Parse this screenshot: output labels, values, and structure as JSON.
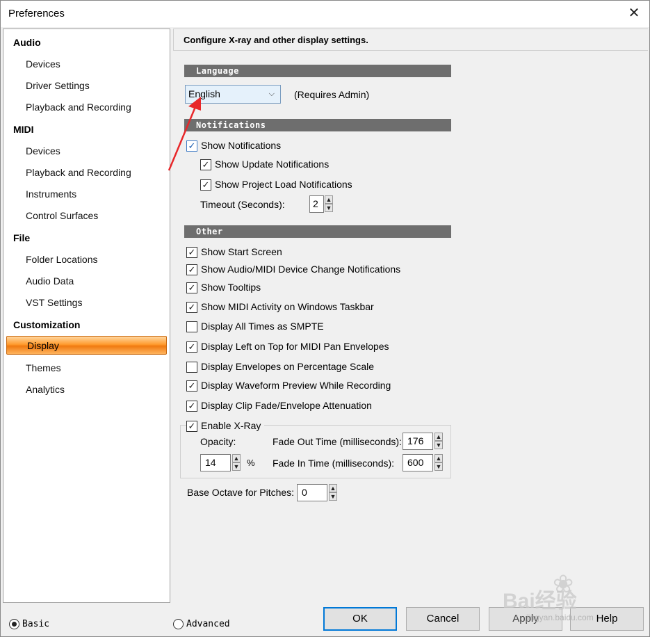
{
  "window": {
    "title": "Preferences",
    "close_glyph": "✕"
  },
  "sidebar": {
    "groups": [
      {
        "label": "Audio",
        "items": [
          "Devices",
          "Driver Settings",
          "Playback and Recording"
        ]
      },
      {
        "label": "MIDI",
        "items": [
          "Devices",
          "Playback and Recording",
          "Instruments",
          "Control Surfaces"
        ]
      },
      {
        "label": "File",
        "items": [
          "Folder Locations",
          "Audio Data",
          "VST Settings"
        ]
      },
      {
        "label": "Customization",
        "items": [
          "Display",
          "Themes",
          "Analytics"
        ]
      }
    ],
    "selected": "Display",
    "selected_color": "#f08a1e"
  },
  "main": {
    "header": "Configure X-ray and other display settings.",
    "language": {
      "section": "Language",
      "value": "English",
      "note": "(Requires Admin)"
    },
    "notifications": {
      "section": "Notifications",
      "show_notifications": {
        "label": "Show Notifications",
        "checked": true
      },
      "show_update": {
        "label": "Show Update Notifications",
        "checked": true
      },
      "show_project_load": {
        "label": "Show Project Load Notifications",
        "checked": true
      },
      "timeout_label": "Timeout (Seconds):",
      "timeout_value": "2"
    },
    "other": {
      "section": "Other",
      "options": [
        {
          "label": "Show Start Screen",
          "checked": true
        },
        {
          "label": "Show Audio/MIDI Device Change Notifications",
          "checked": true
        },
        {
          "label": "Show Tooltips",
          "checked": true
        },
        {
          "label": "Show MIDI Activity on Windows Taskbar",
          "checked": true
        },
        {
          "label": "Display All Times as SMPTE",
          "checked": false
        },
        {
          "label": "Display Left on Top for MIDI Pan Envelopes",
          "checked": true
        },
        {
          "label": "Display Envelopes on Percentage Scale",
          "checked": false
        },
        {
          "label": "Display Waveform Preview While Recording",
          "checked": true
        },
        {
          "label": "Display Clip Fade/Envelope Attenuation",
          "checked": true
        }
      ]
    },
    "xray": {
      "label": "Enable X-Ray",
      "checked": true,
      "opacity_label": "Opacity:",
      "opacity_value": "14",
      "opacity_unit": "%",
      "fade_out_label": "Fade Out Time (milliseconds):",
      "fade_out_value": "176",
      "fade_in_label": "Fade In Time (milliseconds):",
      "fade_in_value": "600"
    },
    "base_octave": {
      "label": "Base Octave for Pitches:",
      "value": "0"
    }
  },
  "footer": {
    "mode_basic": "Basic",
    "mode_advanced": "Advanced",
    "mode_selected": "Basic",
    "ok": "OK",
    "cancel": "Cancel",
    "apply": "Apply",
    "help": "Help"
  },
  "watermark": {
    "text": "Bai经验",
    "url": "jingyan.baidu.com"
  }
}
